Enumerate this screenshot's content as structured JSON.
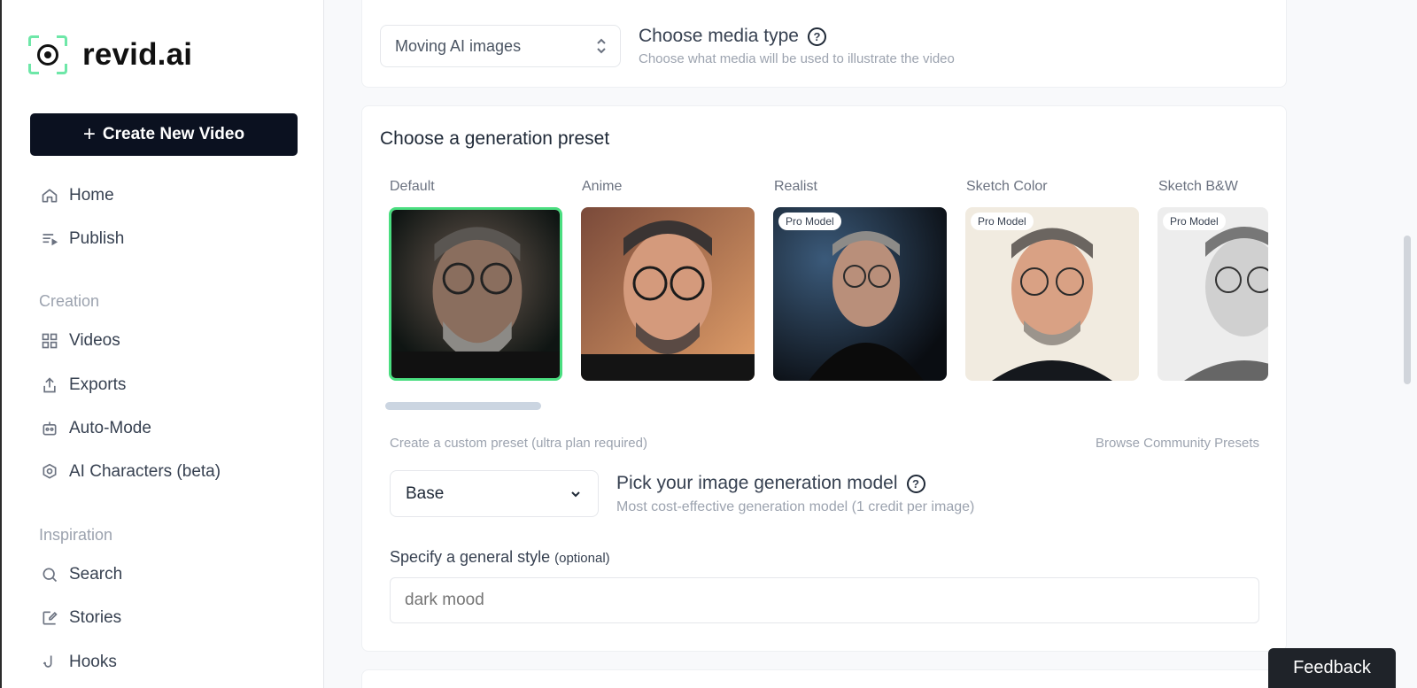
{
  "brand": {
    "name": "revid.ai"
  },
  "sidebar": {
    "create_button": "Create New Video",
    "items": [
      {
        "label": "Home",
        "icon": "home-icon"
      },
      {
        "label": "Publish",
        "icon": "publish-icon"
      }
    ],
    "sections": [
      {
        "title": "Creation",
        "items": [
          {
            "label": "Videos",
            "icon": "grid-icon"
          },
          {
            "label": "Exports",
            "icon": "export-icon"
          },
          {
            "label": "Auto-Mode",
            "icon": "robot-icon"
          },
          {
            "label": "AI Characters (beta)",
            "icon": "character-icon"
          }
        ]
      },
      {
        "title": "Inspiration",
        "items": [
          {
            "label": "Search",
            "icon": "search-icon"
          },
          {
            "label": "Stories",
            "icon": "edit-icon"
          },
          {
            "label": "Hooks",
            "icon": "hook-icon"
          }
        ]
      }
    ]
  },
  "media_type": {
    "selected": "Moving AI images",
    "title": "Choose media type",
    "description": "Choose what media will be used to illustrate the video"
  },
  "presets": {
    "title": "Choose a generation preset",
    "items": [
      {
        "label": "Default",
        "badge": "",
        "selected": true
      },
      {
        "label": "Anime",
        "badge": "",
        "selected": false
      },
      {
        "label": "Realist",
        "badge": "Pro Model",
        "selected": false
      },
      {
        "label": "Sketch Color",
        "badge": "Pro Model",
        "selected": false
      },
      {
        "label": "Sketch B&W",
        "badge": "Pro Model",
        "selected": false
      }
    ],
    "custom_link": "Create a custom preset (ultra plan required)",
    "community_link": "Browse Community Presets"
  },
  "model": {
    "selected": "Base",
    "title": "Pick your image generation model",
    "description": "Most cost-effective generation model (1 credit per image)"
  },
  "style": {
    "label": "Specify a general style",
    "optional": "(optional)",
    "placeholder": "dark mood"
  },
  "feedback": {
    "label": "Feedback"
  },
  "colors": {
    "accent": "#4ade80",
    "primary": "#0b1120"
  }
}
